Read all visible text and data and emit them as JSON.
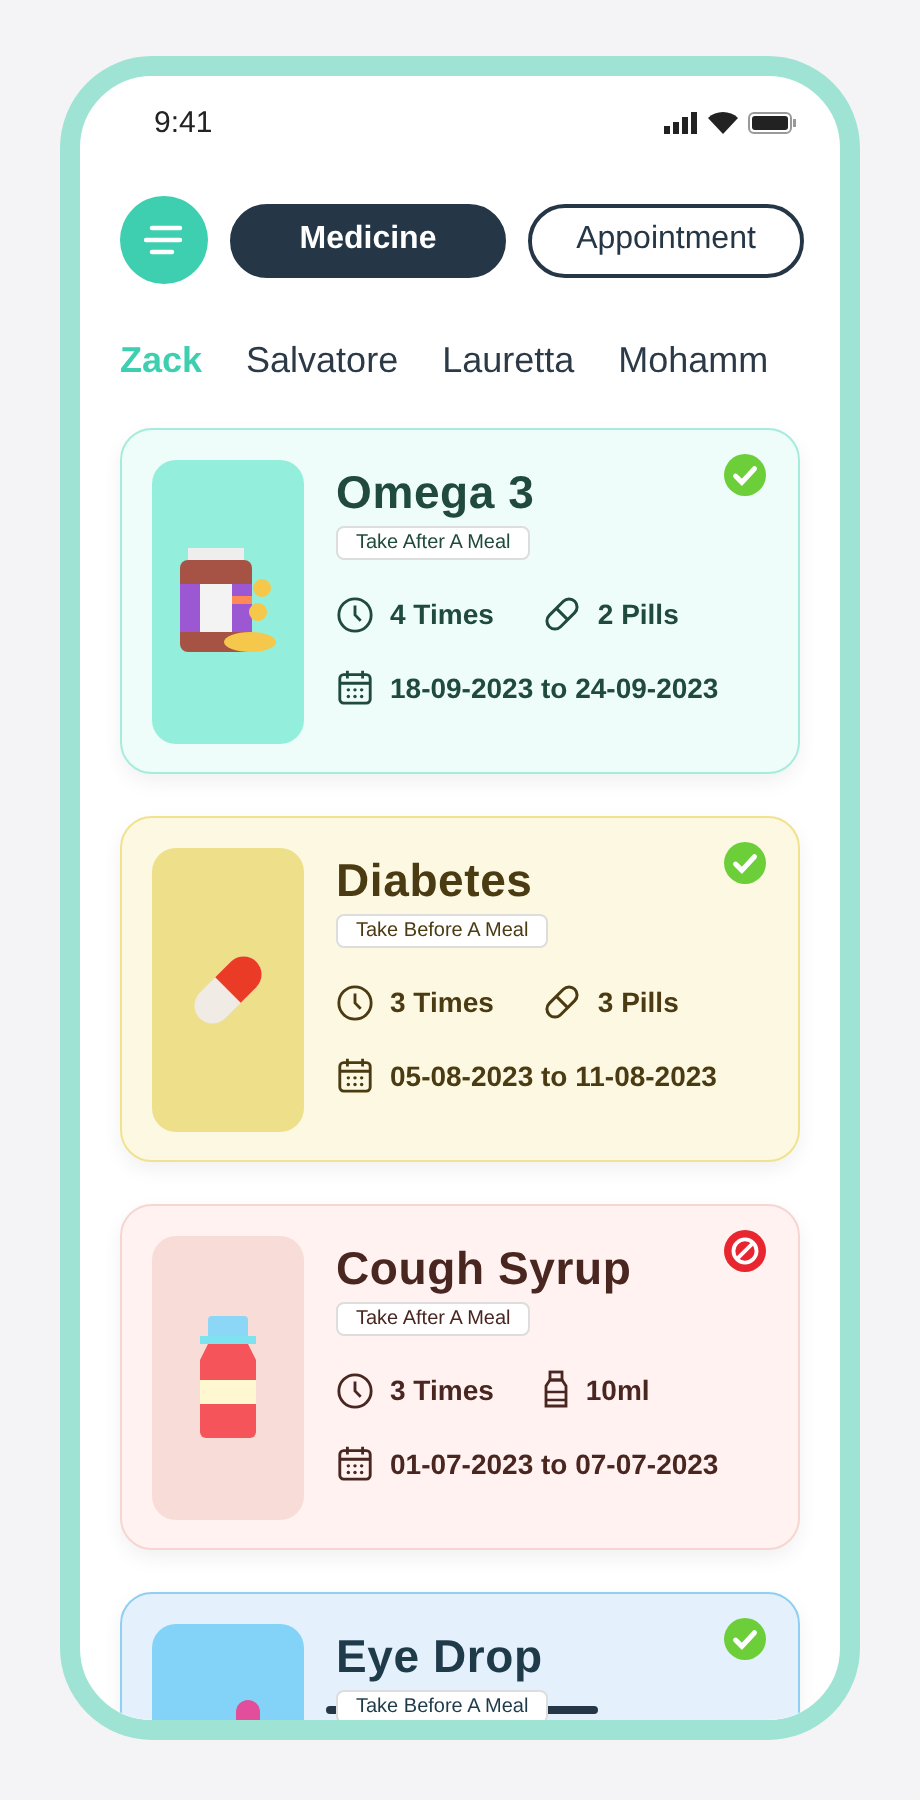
{
  "status_bar": {
    "time": "9:41"
  },
  "segments": [
    {
      "label": "Medicine",
      "selected": true
    },
    {
      "label": "Appointment",
      "selected": false
    }
  ],
  "people": [
    {
      "name": "Zack",
      "selected": true
    },
    {
      "name": "Salvatore",
      "selected": false
    },
    {
      "name": "Lauretta",
      "selected": false
    },
    {
      "name": "Mohamm",
      "selected": false
    }
  ],
  "medicines": [
    {
      "name": "Omega 3",
      "kind": "supplement",
      "color": "#eefdf9",
      "taken": true,
      "instruction": "Take After A Meal",
      "times": "4 Times",
      "dose": {
        "kind": "pills",
        "text": "2 Pills"
      },
      "dates": "18-09-2023 to 24-09-2023"
    },
    {
      "name": "Diabetes",
      "kind": "capsule",
      "color": "#fdf8e1",
      "taken": true,
      "instruction": "Take Before A Meal",
      "times": "3 Times",
      "dose": {
        "kind": "pills",
        "text": "3 Pills"
      },
      "dates": "05-08-2023 to 11-08-2023"
    },
    {
      "name": "Cough Syrup",
      "kind": "syrup",
      "color": "#fff2f0",
      "taken": false,
      "instruction": "Take After A Meal",
      "times": "3 Times",
      "dose": {
        "kind": "liquid",
        "text": "10ml"
      },
      "dates": "01-07-2023 to 07-07-2023"
    },
    {
      "name": "Eye Drop",
      "kind": "drops",
      "color": "#e4f1fd",
      "taken": true,
      "instruction": "Take Before A Meal"
    }
  ]
}
